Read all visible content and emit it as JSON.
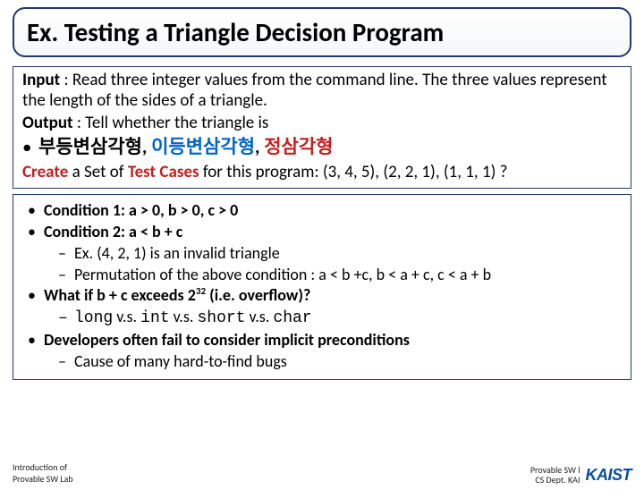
{
  "title": "Ex. Testing a Triangle Decision Program",
  "upper": {
    "input_label": "Input",
    "input_text": " : Read three integer values from the command line. The three values represent the length of the sides of a triangle.",
    "output_label": "Output",
    "output_text": " : Tell whether the triangle is",
    "triangle_scalene": "부등변삼각형",
    "triangle_isosceles": "이등변삼각형",
    "triangle_equilateral": "정삼각형",
    "sep": ", ",
    "create_pre": "Create",
    "create_mid": " a Set of ",
    "create_tc": "Test Cases",
    "create_post": " for this program: (3, 4, 5), (2, 2, 1), (1, 1, 1) ?"
  },
  "lower": {
    "c1": "Condition 1: a > 0, b > 0, c > 0",
    "c2": "Condition 2: a < b + c",
    "c2ex": "Ex. (4, 2, 1) is an invalid triangle",
    "c2perm": "Permutation of the above condition : a < b +c, b < a + c, c < a + b",
    "ov_pre": "What if b + c exceeds 2",
    "ov_exp": "32",
    "ov_post": " (i.e. overflow)?",
    "types_long": "long",
    "types_int": "int",
    "types_short": "short",
    "types_char": "char",
    "vs": " v.s. ",
    "dev": "Developers often fail to consider implicit preconditions",
    "cause": "Cause of many hard-to-find bugs"
  },
  "footer": {
    "left1": "Introduction of",
    "left2": "Provable SW Lab",
    "right1": "Provable SW l",
    "right2": "CS Dept. KAI",
    "logo": "KAIST"
  }
}
